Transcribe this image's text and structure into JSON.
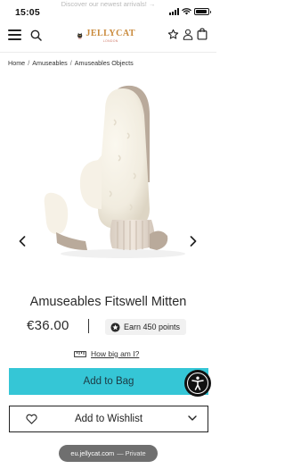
{
  "status_bar": {
    "time": "15:05",
    "battery_level": 0.9
  },
  "promo_text": "Discover our newest arrivals! →",
  "header": {
    "logo_text": "JELLYCAT",
    "logo_sub": "LONDON"
  },
  "breadcrumb": {
    "items": [
      "Home",
      "Amuseables",
      "Amuseables Objects"
    ],
    "separator": "/"
  },
  "product": {
    "title": "Amuseables Fitswell Mitten",
    "price": "€36.00",
    "points": "Earn 450 points",
    "size_link": "How big am I?"
  },
  "actions": {
    "add_to_bag": "Add to Bag",
    "add_to_wishlist": "Add to Wishlist"
  },
  "browser": {
    "url": "eu.jellycat.com",
    "mode": "— Private"
  },
  "colors": {
    "accent": "#35c6d6",
    "logo": "#c9893a"
  }
}
